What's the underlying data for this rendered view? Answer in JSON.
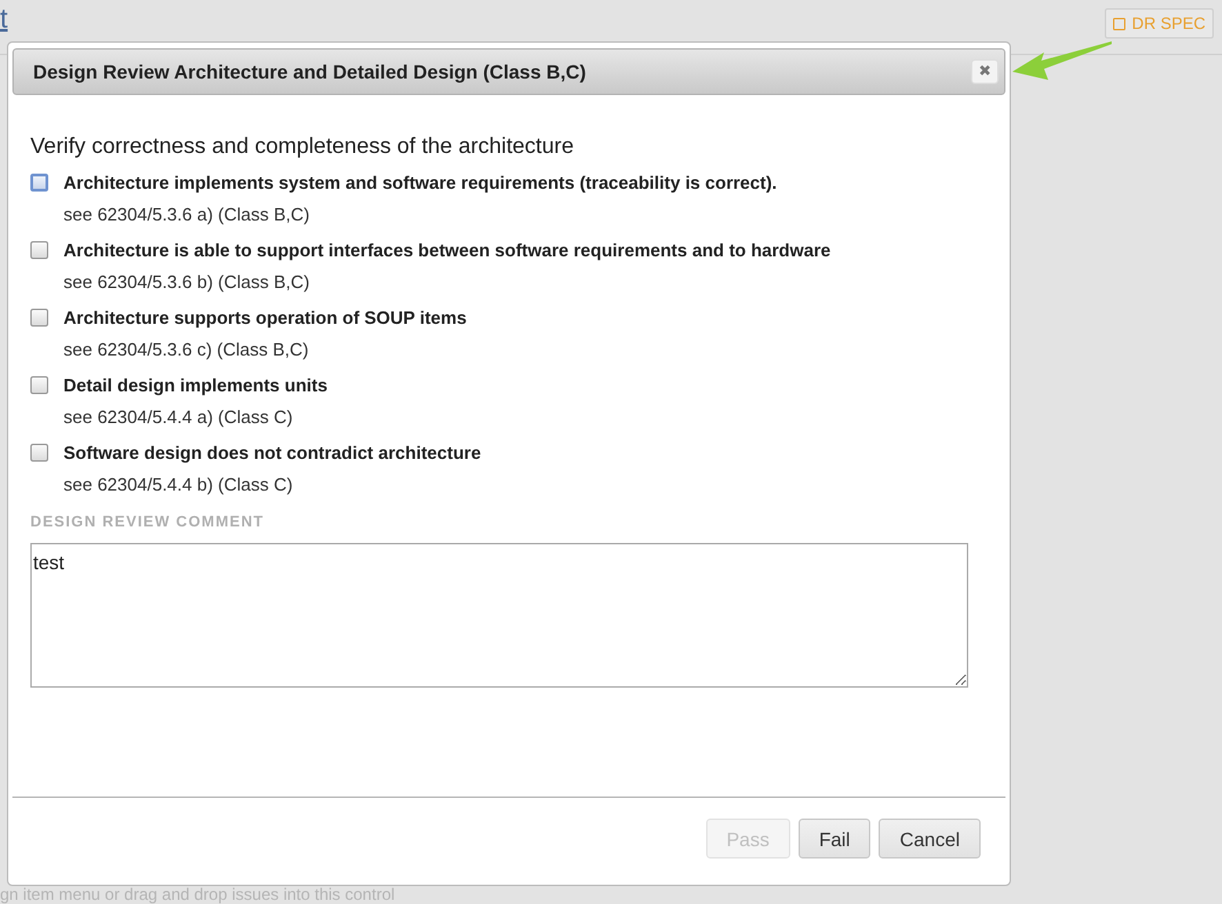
{
  "page": {
    "link": "t",
    "spec_button": "DR SPEC",
    "footer_hint": "gn item menu or drag and drop issues into this control"
  },
  "dialog": {
    "title": "Design Review Architecture and Detailed Design (Class B,C)",
    "close": "✖",
    "section_title": "Verify correctness and completeness of the architecture",
    "items": [
      {
        "label": "Architecture implements system and software requirements (traceability is correct).",
        "ref": "see 62304/5.3.6 a) (Class B,C)",
        "checked": false,
        "focused": true
      },
      {
        "label": "Architecture is able to support interfaces between software requirements and to hardware",
        "ref": "see 62304/5.3.6 b) (Class B,C)",
        "checked": false,
        "focused": false
      },
      {
        "label": "Architecture supports operation of SOUP items",
        "ref": "see 62304/5.3.6 c) (Class B,C)",
        "checked": false,
        "focused": false
      },
      {
        "label": "Detail design implements units",
        "ref": "see 62304/5.4.4 a) (Class C)",
        "checked": false,
        "focused": false
      },
      {
        "label": "Software design does not contradict architecture",
        "ref": "see 62304/5.4.4 b) (Class C)",
        "checked": false,
        "focused": false
      }
    ],
    "comment_label": "DESIGN REVIEW COMMENT",
    "comment": "test",
    "buttons": [
      {
        "label": "Pass",
        "disabled": true
      },
      {
        "label": "Fail",
        "disabled": false
      },
      {
        "label": "Cancel",
        "disabled": false
      }
    ]
  }
}
